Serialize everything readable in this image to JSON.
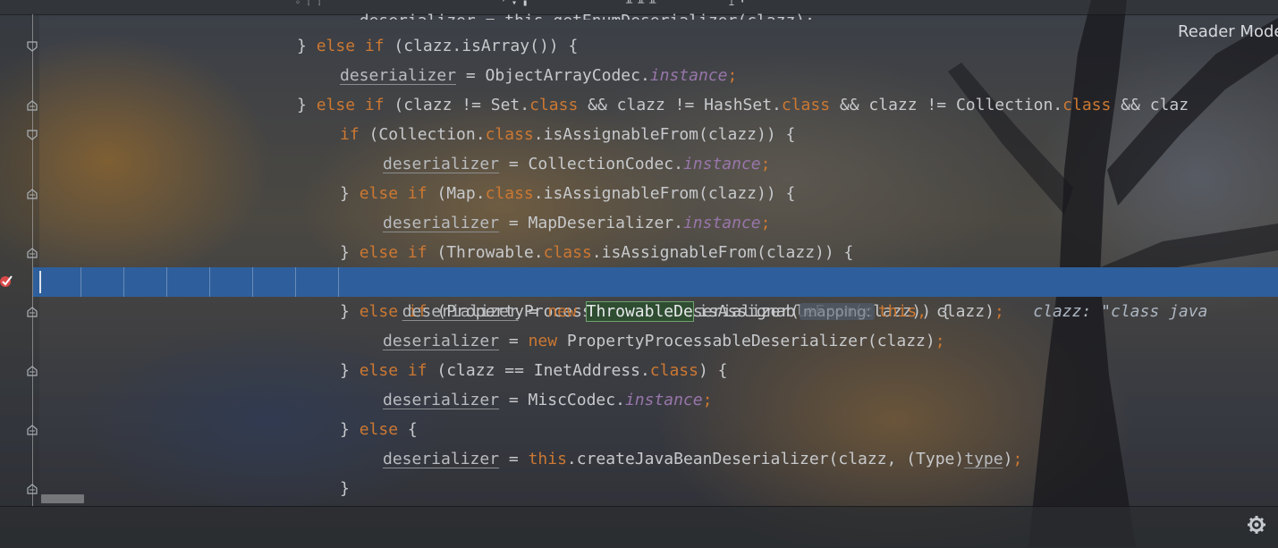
{
  "editor": {
    "reader_mode_label": "Reader Mode",
    "top_partial_text": "deserializer = this.getEnumDeserializer(clazz);",
    "lines": [
      {
        "segments": [
          [
            "plain",
            "} "
          ],
          [
            "kw",
            "else if"
          ],
          [
            "plain",
            " (clazz.isArray()) {"
          ]
        ]
      },
      {
        "segments": [
          [
            "var",
            "deserializer"
          ],
          [
            "plain",
            " = ObjectArrayCodec."
          ],
          [
            "field",
            "instance"
          ],
          [
            "semi",
            ";"
          ]
        ]
      },
      {
        "segments": [
          [
            "plain",
            "} "
          ],
          [
            "kw",
            "else if"
          ],
          [
            "plain",
            " (clazz != Set."
          ],
          [
            "kw",
            "class"
          ],
          [
            "plain",
            " && clazz != HashSet."
          ],
          [
            "kw",
            "class"
          ],
          [
            "plain",
            " && clazz != Collection."
          ],
          [
            "kw",
            "class"
          ],
          [
            "plain",
            " && claz"
          ]
        ]
      },
      {
        "segments": [
          [
            "kw",
            "if"
          ],
          [
            "plain",
            " (Collection."
          ],
          [
            "kw",
            "class"
          ],
          [
            "plain",
            ".isAssignableFrom(clazz)) {"
          ]
        ]
      },
      {
        "segments": [
          [
            "var",
            "deserializer"
          ],
          [
            "plain",
            " = CollectionCodec."
          ],
          [
            "field",
            "instance"
          ],
          [
            "semi",
            ";"
          ]
        ]
      },
      {
        "segments": [
          [
            "plain",
            "} "
          ],
          [
            "kw",
            "else if"
          ],
          [
            "plain",
            " (Map."
          ],
          [
            "kw",
            "class"
          ],
          [
            "plain",
            ".isAssignableFrom(clazz)) {"
          ]
        ]
      },
      {
        "segments": [
          [
            "var",
            "deserializer"
          ],
          [
            "plain",
            " = MapDeserializer."
          ],
          [
            "field",
            "instance"
          ],
          [
            "semi",
            ";"
          ]
        ]
      },
      {
        "segments": [
          [
            "plain",
            "} "
          ],
          [
            "kw",
            "else if"
          ],
          [
            "plain",
            " (Throwable."
          ],
          [
            "kw",
            "class"
          ],
          [
            "plain",
            ".isAssignableFrom(clazz)) {"
          ]
        ]
      },
      {
        "segments": []
      },
      {
        "segments": [
          [
            "plain",
            "} "
          ],
          [
            "kw",
            "else if"
          ],
          [
            "plain",
            " (PropertyProcessable."
          ],
          [
            "kw",
            "class"
          ],
          [
            "plain",
            ".isAssignableFrom(clazz)) {"
          ]
        ]
      },
      {
        "segments": [
          [
            "var",
            "deserializer"
          ],
          [
            "plain",
            " = "
          ],
          [
            "kw",
            "new"
          ],
          [
            "plain",
            " PropertyProcessableDeserializer(clazz)"
          ],
          [
            "semi",
            ";"
          ]
        ]
      },
      {
        "segments": [
          [
            "plain",
            "} "
          ],
          [
            "kw",
            "else if"
          ],
          [
            "plain",
            " (clazz == InetAddress."
          ],
          [
            "kw",
            "class"
          ],
          [
            "plain",
            ") {"
          ]
        ]
      },
      {
        "segments": [
          [
            "var",
            "deserializer"
          ],
          [
            "plain",
            " = MiscCodec."
          ],
          [
            "field",
            "instance"
          ],
          [
            "semi",
            ";"
          ]
        ]
      },
      {
        "segments": [
          [
            "plain",
            "} "
          ],
          [
            "kw",
            "else"
          ],
          [
            "plain",
            " {"
          ]
        ]
      },
      {
        "segments": [
          [
            "var",
            "deserializer"
          ],
          [
            "plain",
            " = "
          ],
          [
            "kw",
            "this"
          ],
          [
            "plain",
            ".createJavaBeanDeserializer(clazz, (Type)"
          ],
          [
            "var",
            "type"
          ],
          [
            "plain",
            ")"
          ],
          [
            "semi",
            ";"
          ]
        ]
      },
      {
        "segments": [
          [
            "plain",
            "}"
          ]
        ]
      }
    ],
    "exec_line": {
      "var": "deserializer",
      "eq": " = ",
      "kw_new": "new",
      "space": " ",
      "highlight": "ThrowableDe",
      "rest": "serializer(",
      "param_hint": "mapping:",
      "kw_this": "this,",
      "args": " clazz)",
      "semi": ";",
      "inline_value": "clazz: \"class java"
    }
  }
}
